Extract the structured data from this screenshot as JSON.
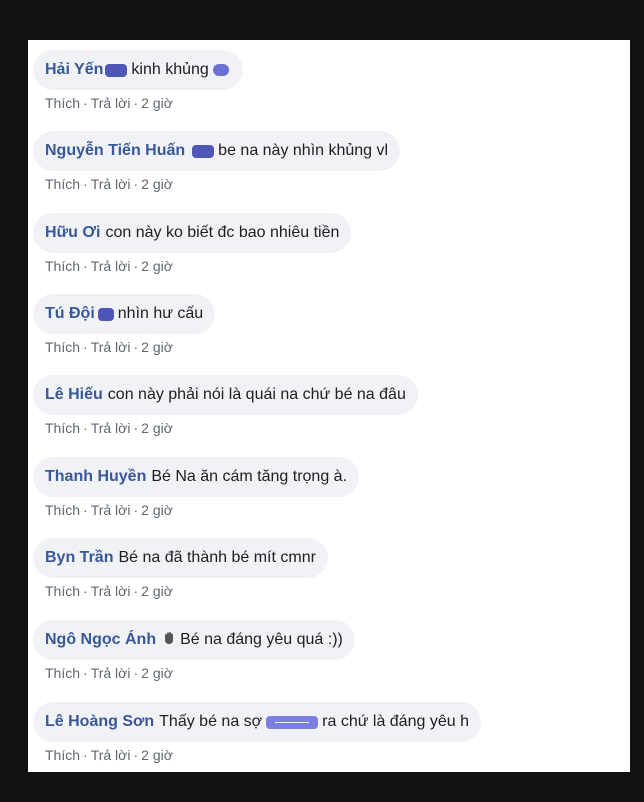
{
  "comments": [
    {
      "author": "Hải Yến",
      "text": "kinh khủng",
      "like_label": "Thích",
      "reply_label": "Trả lời",
      "time": "2 giờ"
    },
    {
      "author": "Nguyễn Tiến Huấn",
      "text": "be na này nhìn khủng vl",
      "like_label": "Thích",
      "reply_label": "Trả lời",
      "time": "2 giờ"
    },
    {
      "author": "Hữu Ơi",
      "text": "con này ko biết đc bao nhiêu tiền",
      "like_label": "Thích",
      "reply_label": "Trả lời",
      "time": "2 giờ"
    },
    {
      "author": "Tú Đội",
      "text": "nhìn hư cấu",
      "like_label": "Thích",
      "reply_label": "Trả lời",
      "time": "2 giờ"
    },
    {
      "author": "Lê Hiếu",
      "text": "con này phải nói là quái na chứ bé na đâu",
      "like_label": "Thích",
      "reply_label": "Trả lời",
      "time": "2 giờ"
    },
    {
      "author": "Thanh Huyền",
      "text": "Bé Na ăn cám tăng trọng à.",
      "like_label": "Thích",
      "reply_label": "Trả lời",
      "time": "2 giờ"
    },
    {
      "author": "Byn Trần",
      "text": "Bé na đã thành bé mít cmnr",
      "like_label": "Thích",
      "reply_label": "Trả lời",
      "time": "2 giờ"
    },
    {
      "author": "Ngô Ngọc Ánh",
      "text": "Bé na đáng yêu quá :))",
      "like_label": "Thích",
      "reply_label": "Trả lời",
      "time": "2 giờ"
    },
    {
      "author": "Lê Hoàng Sơn",
      "text_before": "Thấy bé na sợ",
      "text_after": "ra chứ là đáng yêu h",
      "like_label": "Thích",
      "reply_label": "Trả lời",
      "time": "2 giờ"
    }
  ],
  "separator": "·",
  "colors": {
    "background": "#121212",
    "bubble": "#f0f2f5",
    "author": "#385898",
    "redaction": "#6a6fd3"
  },
  "icons": {
    "wave": "waving-hand-icon"
  }
}
